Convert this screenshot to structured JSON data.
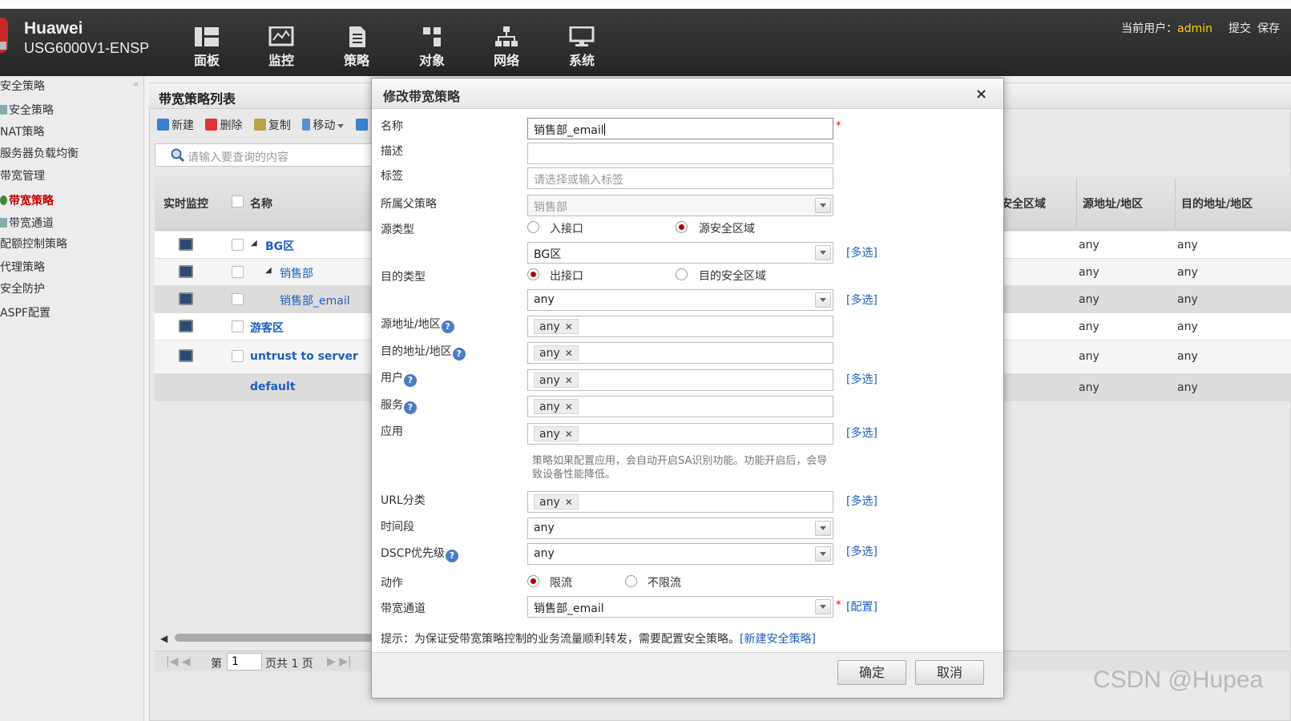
{
  "header": {
    "brand": "Huawei",
    "model": "USG6000V1-ENSP",
    "nav": [
      {
        "label": "面板",
        "icon": "dashboard-icon"
      },
      {
        "label": "监控",
        "icon": "monitor-icon"
      },
      {
        "label": "策略",
        "icon": "policy-icon"
      },
      {
        "label": "对象",
        "icon": "object-icon"
      },
      {
        "label": "网络",
        "icon": "network-icon"
      },
      {
        "label": "系统",
        "icon": "system-icon"
      }
    ],
    "current_user_label": "当前用户：",
    "current_user": "admin",
    "submit": "提交",
    "save": "保存"
  },
  "sidebar": {
    "items": [
      {
        "label": "安全策略"
      },
      {
        "label": "安全策略"
      },
      {
        "label": "NAT策略"
      },
      {
        "label": "服务器负载均衡"
      },
      {
        "label": "带宽管理"
      },
      {
        "label": "带宽策略"
      },
      {
        "label": "带宽通道"
      },
      {
        "label": "配额控制策略"
      },
      {
        "label": "代理策略"
      },
      {
        "label": "安全防护"
      },
      {
        "label": "ASPF配置"
      }
    ],
    "active": "带宽策略",
    "collapse_glyph": "«"
  },
  "panel": {
    "title": "带宽策略列表",
    "toolbar": {
      "new": "新建",
      "delete": "删除",
      "copy": "复制",
      "move": "移动"
    },
    "search_placeholder": "请输入要查询的内容",
    "columns": {
      "monitor": "实时监控",
      "name": "名称",
      "src_zone": "安全区域",
      "src_addr": "源地址/地区",
      "dst_addr": "目的地址/地区"
    },
    "rows": [
      {
        "name": "BG区",
        "src": "any",
        "dst": "any"
      },
      {
        "name": "销售部",
        "src": "any",
        "dst": "any"
      },
      {
        "name": "销售部_email",
        "src": "any",
        "dst": "any"
      },
      {
        "name": "游客区",
        "src": "any",
        "dst": "any"
      },
      {
        "name": "untrust to server",
        "src": "any",
        "dst": "any"
      },
      {
        "name": "default",
        "src": "any",
        "dst": "any"
      }
    ],
    "pager": {
      "page_prefix": "第",
      "page": "1",
      "page_suffix": "页共 1 页"
    }
  },
  "dialog": {
    "title": "修改带宽策略",
    "close": "×",
    "labels": {
      "name": "名称",
      "desc": "描述",
      "tag": "标签",
      "parent": "所属父策略",
      "src_type": "源类型",
      "dst_type": "目的类型",
      "src_addr": "源地址/地区",
      "dst_addr": "目的地址/地区",
      "user": "用户",
      "service": "服务",
      "app": "应用",
      "url": "URL分类",
      "time": "时间段",
      "dscp": "DSCP优先级",
      "action": "动作",
      "channel": "带宽通道"
    },
    "values": {
      "name": "销售部_email",
      "desc": "",
      "tag_placeholder": "请选择或输入标签",
      "parent": "销售部",
      "src_zone": "BG区",
      "dst_iface": "any",
      "src_addr_tag": "any",
      "dst_addr_tag": "any",
      "user_tag": "any",
      "service_tag": "any",
      "app_tag": "any",
      "url_tag": "any",
      "time": "any",
      "dscp": "any",
      "channel": "销售部_email"
    },
    "radios": {
      "src_iface": "入接口",
      "src_zone": "源安全区域",
      "dst_iface": "出接口",
      "dst_zone": "目的安全区域",
      "limit": "限流",
      "nolimit": "不限流"
    },
    "multi": "[多选]",
    "config": "[配置]",
    "required": "*",
    "help": "?",
    "tag_close": "✕",
    "app_note": "策略如果配置应用，会自动开启SA识别功能。功能开启后，会导致设备性能降低。",
    "hint_text": "提示：为保证受带宽策略控制的业务流量顺利转发，需要配置安全策略。",
    "hint_link": "[新建安全策略]",
    "ok": "确定",
    "cancel": "取消"
  },
  "watermark": "CSDN @Hupea"
}
